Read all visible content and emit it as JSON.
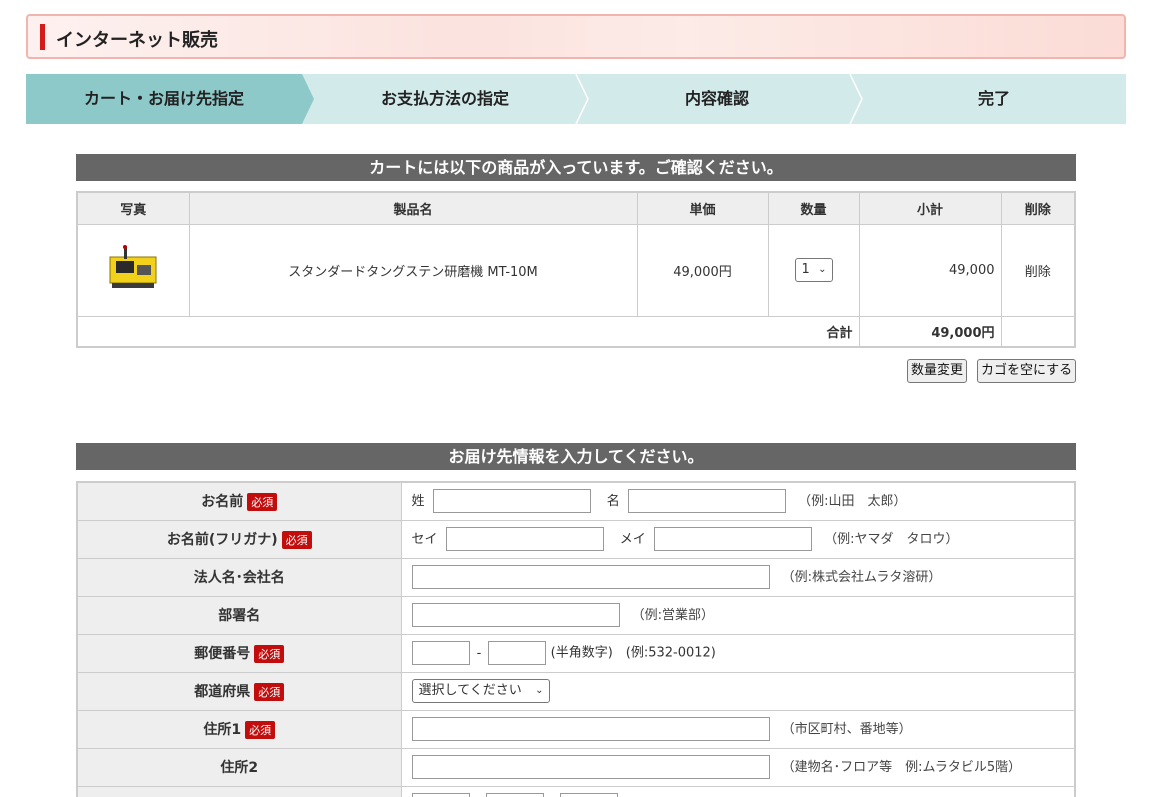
{
  "header": {
    "title": "インターネット販売"
  },
  "steps": [
    {
      "label": "カート・お届け先指定"
    },
    {
      "label": "お支払方法の指定"
    },
    {
      "label": "内容確認"
    },
    {
      "label": "完了"
    }
  ],
  "cart": {
    "section_title": "カートには以下の商品が入っています。ご確認ください。",
    "headers": {
      "photo": "写真",
      "name": "製品名",
      "price": "単価",
      "qty": "数量",
      "subtotal": "小計",
      "delete": "削除"
    },
    "item": {
      "name": "スタンダードタングステン研磨機 MT-10M",
      "price": "49,000円",
      "qty": "1",
      "subtotal": "49,000",
      "delete": "削除"
    },
    "total_label": "合計",
    "total_value": "49,000円",
    "buttons": {
      "update_qty": "数量変更",
      "empty_cart": "カゴを空にする"
    }
  },
  "form": {
    "section_title": "お届け先情報を入力してください。",
    "required_badge": "必須",
    "rows": {
      "name": {
        "label": "お名前",
        "sei": "姓",
        "mei": "名",
        "hint": "（例:山田　太郎）"
      },
      "kana": {
        "label": "お名前(フリガナ)",
        "sei": "セイ",
        "mei": "メイ",
        "hint": "（例:ヤマダ　タロウ）"
      },
      "company": {
        "label": "法人名･会社名",
        "hint": "（例:株式会社ムラタ溶研）"
      },
      "dept": {
        "label": "部署名",
        "hint": "（例:営業部）"
      },
      "zip": {
        "label": "郵便番号",
        "sep": "-",
        "hint": "(半角数字)　(例:532-0012)"
      },
      "pref": {
        "label": "都道府県",
        "selected": "選択してください"
      },
      "addr1": {
        "label": "住所1",
        "hint": "（市区町村、番地等）"
      },
      "addr2": {
        "label": "住所2",
        "hint": "（建物名･フロア等　例:ムラタビル5階）"
      }
    }
  }
}
